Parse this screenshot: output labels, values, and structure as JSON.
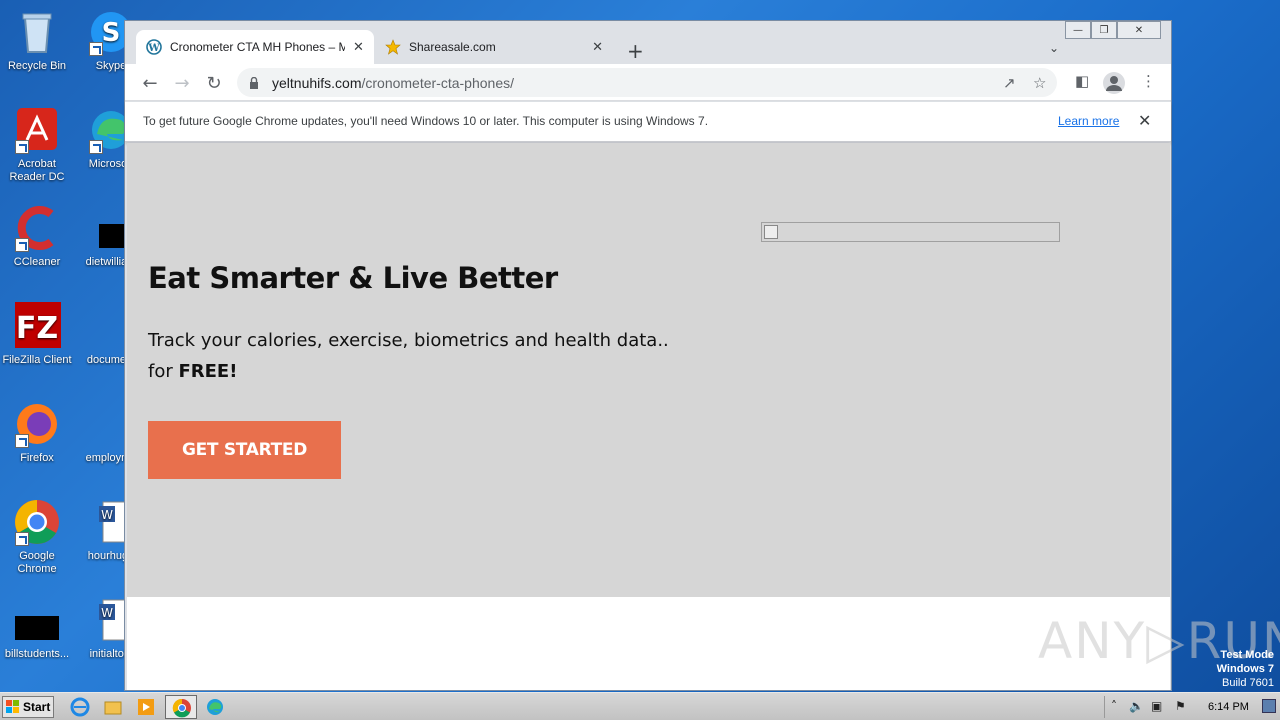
{
  "desktop": {
    "icons": [
      {
        "label": "Recycle Bin"
      },
      {
        "label": "Skype"
      },
      {
        "label": "Acrobat Reader DC"
      },
      {
        "label": "Microsoft"
      },
      {
        "label": "CCleaner"
      },
      {
        "label": "dietwilliam"
      },
      {
        "label": "FileZilla Client"
      },
      {
        "label": "document"
      },
      {
        "label": "Firefox"
      },
      {
        "label": "employme"
      },
      {
        "label": "Google Chrome"
      },
      {
        "label": "hourhuge"
      },
      {
        "label": "billstudents..."
      },
      {
        "label": "initialtold"
      }
    ]
  },
  "browser": {
    "tabs": [
      {
        "title": "Cronometer CTA MH Phones – My Bl",
        "icon": "wordpress-icon",
        "active": true
      },
      {
        "title": "Shareasale.com",
        "icon": "star-icon",
        "active": false
      }
    ],
    "url_host": "yeltnuhifs.com",
    "url_path": "/cronometer-cta-phones/",
    "infobar": {
      "message": "To get future Google Chrome updates, you'll need Windows 10 or later. This computer is using Windows 7.",
      "link": "Learn more"
    }
  },
  "page": {
    "heading": "Eat Smarter & Live Better",
    "subtitle_line1": "Track your calories, exercise, biometrics and health data..",
    "subtitle_line2_prefix": "for ",
    "subtitle_line2_bold": "FREE!",
    "cta_label": "GET STARTED",
    "colors": {
      "hero_bg": "#d6d6d6",
      "cta_bg": "#e8704d"
    }
  },
  "taskbar": {
    "start_label": "Start",
    "clock": "6:14 PM"
  },
  "watermark": {
    "line1": "Test Mode",
    "line2": "Windows 7",
    "line3": "Build 7601",
    "brand": "ANY RUN"
  }
}
